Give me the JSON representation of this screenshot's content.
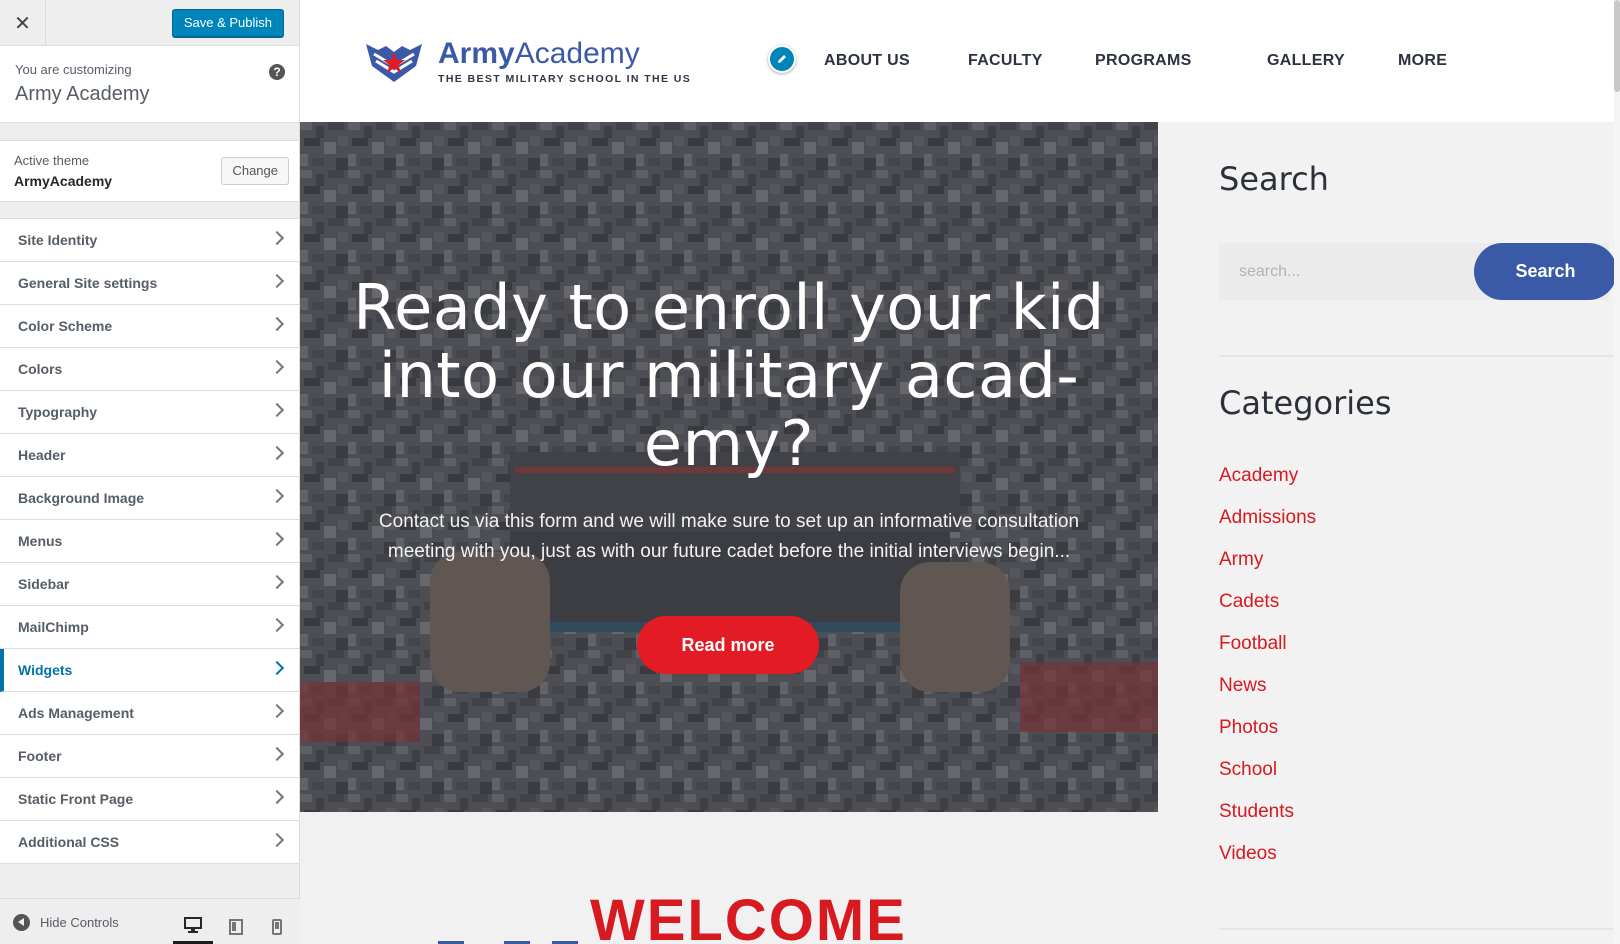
{
  "customizer": {
    "close_icon": "close-icon",
    "save_label": "Save & Publish",
    "customizing_label": "You are customizing",
    "site_name": "Army Academy",
    "help_icon": "help-icon",
    "active_theme_label": "Active theme",
    "active_theme_name": "ArmyAcademy",
    "change_label": "Change",
    "sections": [
      {
        "label": "Site Identity"
      },
      {
        "label": "General Site settings"
      },
      {
        "label": "Color Scheme"
      },
      {
        "label": "Colors"
      },
      {
        "label": "Typography"
      },
      {
        "label": "Header"
      },
      {
        "label": "Background Image"
      },
      {
        "label": "Menus"
      },
      {
        "label": "Sidebar"
      },
      {
        "label": "MailChimp"
      },
      {
        "label": "Widgets",
        "active": true
      },
      {
        "label": "Ads Management"
      },
      {
        "label": "Footer"
      },
      {
        "label": "Static Front Page"
      },
      {
        "label": "Additional CSS"
      }
    ],
    "hide_controls_label": "Hide Controls",
    "devices": [
      "desktop-icon",
      "tablet-icon",
      "mobile-icon"
    ],
    "active_device": "desktop"
  },
  "site": {
    "logo": {
      "brand_bold": "Army",
      "brand_regular": "Academy",
      "tagline": "THE BEST MILITARY SCHOOL IN THE US"
    },
    "nav": [
      {
        "label": "ABOUT US"
      },
      {
        "label": "FACULTY"
      },
      {
        "label": "PROGRAMS"
      },
      {
        "label": "GALLERY"
      },
      {
        "label": "MORE"
      }
    ],
    "hero": {
      "title": "Ready to enroll your kid into our military acad-emy?",
      "title_lines": [
        "Ready to enroll your kid",
        "into our military acad-",
        "emy?"
      ],
      "text": "Contact us via this form and we will make sure to set up an informative consultation meeting with you, just as with our future cadet before the initial interviews begin...",
      "button": "Read more"
    },
    "welcome_partial": "WELCOME",
    "sidebar": {
      "search_title": "Search",
      "search_placeholder": "search...",
      "search_button": "Search",
      "categories_title": "Categories",
      "categories": [
        "Academy",
        "Admissions",
        "Army",
        "Cadets",
        "Football",
        "News",
        "Photos",
        "School",
        "Students",
        "Videos"
      ]
    }
  },
  "colors": {
    "wp_primary": "#0085ba",
    "brand_blue": "#3a5aa8",
    "brand_red": "#e21b25",
    "category_red": "#d71920"
  }
}
